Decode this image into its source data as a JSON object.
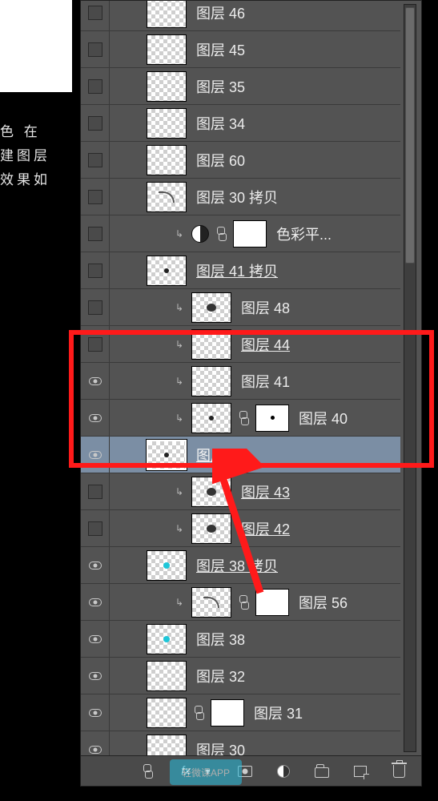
{
  "side_text": {
    "line1": "色   在",
    "line2": "建图层",
    "line3": "效果如"
  },
  "layers": [
    {
      "name": "图层 46",
      "visible": false,
      "indent": 1,
      "clip": false,
      "mask": false,
      "adj": false,
      "selected": false,
      "underline": false,
      "thumb": "checker"
    },
    {
      "name": "图层 45",
      "visible": false,
      "indent": 1,
      "clip": false,
      "mask": false,
      "adj": false,
      "selected": false,
      "underline": false,
      "thumb": "checker"
    },
    {
      "name": "图层 35",
      "visible": false,
      "indent": 1,
      "clip": false,
      "mask": false,
      "adj": false,
      "selected": false,
      "underline": false,
      "thumb": "checker"
    },
    {
      "name": "图层 34",
      "visible": false,
      "indent": 1,
      "clip": false,
      "mask": false,
      "adj": false,
      "selected": false,
      "underline": false,
      "thumb": "checker"
    },
    {
      "name": "图层 60",
      "visible": false,
      "indent": 1,
      "clip": false,
      "mask": false,
      "adj": false,
      "selected": false,
      "underline": false,
      "thumb": "checker"
    },
    {
      "name": "图层 30 拷贝",
      "visible": false,
      "indent": 1,
      "clip": false,
      "mask": false,
      "adj": false,
      "selected": false,
      "underline": false,
      "thumb": "arc"
    },
    {
      "name": "色彩平...",
      "visible": false,
      "indent": 2,
      "clip": true,
      "mask": true,
      "adj": true,
      "selected": false,
      "underline": false,
      "thumb": "adj"
    },
    {
      "name": "图层 41 拷贝",
      "visible": false,
      "indent": 1,
      "clip": false,
      "mask": false,
      "adj": false,
      "selected": false,
      "underline": true,
      "thumb": "dot"
    },
    {
      "name": "图层 48",
      "visible": false,
      "indent": 2,
      "clip": true,
      "mask": false,
      "adj": false,
      "selected": false,
      "underline": false,
      "thumb": "blob"
    },
    {
      "name": "图层 44",
      "visible": false,
      "indent": 2,
      "clip": true,
      "mask": false,
      "adj": false,
      "selected": false,
      "underline": true,
      "thumb": "checker"
    },
    {
      "name": "图层 41",
      "visible": true,
      "indent": 2,
      "clip": true,
      "mask": false,
      "adj": false,
      "selected": false,
      "underline": false,
      "thumb": "checker"
    },
    {
      "name": "图层 40",
      "visible": true,
      "indent": 2,
      "clip": true,
      "mask": true,
      "adj": false,
      "selected": false,
      "underline": false,
      "thumb": "dot"
    },
    {
      "name": "图层 39",
      "visible": true,
      "indent": 1,
      "clip": false,
      "mask": false,
      "adj": false,
      "selected": true,
      "underline": true,
      "thumb": "dot"
    },
    {
      "name": "图层 43",
      "visible": false,
      "indent": 2,
      "clip": true,
      "mask": false,
      "adj": false,
      "selected": false,
      "underline": true,
      "thumb": "blob"
    },
    {
      "name": "图层 42",
      "visible": false,
      "indent": 2,
      "clip": true,
      "mask": false,
      "adj": false,
      "selected": false,
      "underline": true,
      "thumb": "blob"
    },
    {
      "name": "图层 38 拷贝",
      "visible": true,
      "indent": 1,
      "clip": false,
      "mask": false,
      "adj": false,
      "selected": false,
      "underline": true,
      "thumb": "cyan"
    },
    {
      "name": "图层 56",
      "visible": true,
      "indent": 2,
      "clip": true,
      "mask": true,
      "adj": false,
      "selected": false,
      "underline": false,
      "thumb": "arc"
    },
    {
      "name": "图层 38",
      "visible": true,
      "indent": 1,
      "clip": false,
      "mask": false,
      "adj": false,
      "selected": false,
      "underline": false,
      "thumb": "cyan"
    },
    {
      "name": "图层 32",
      "visible": true,
      "indent": 1,
      "clip": false,
      "mask": false,
      "adj": false,
      "selected": false,
      "underline": false,
      "thumb": "checker"
    },
    {
      "name": "图层 31",
      "visible": true,
      "indent": 1,
      "clip": false,
      "mask": true,
      "adj": false,
      "selected": false,
      "underline": false,
      "thumb": "checker"
    },
    {
      "name": "图层 30",
      "visible": true,
      "indent": 1,
      "clip": false,
      "mask": false,
      "adj": false,
      "selected": false,
      "underline": false,
      "thumb": "checker"
    }
  ],
  "bottom_bar": {
    "link": "link",
    "fx": "fx",
    "mask": "add-mask",
    "adj": "adjustment",
    "folder": "group",
    "new": "new-layer",
    "trash": "delete"
  },
  "watermark": "轻微课APP"
}
